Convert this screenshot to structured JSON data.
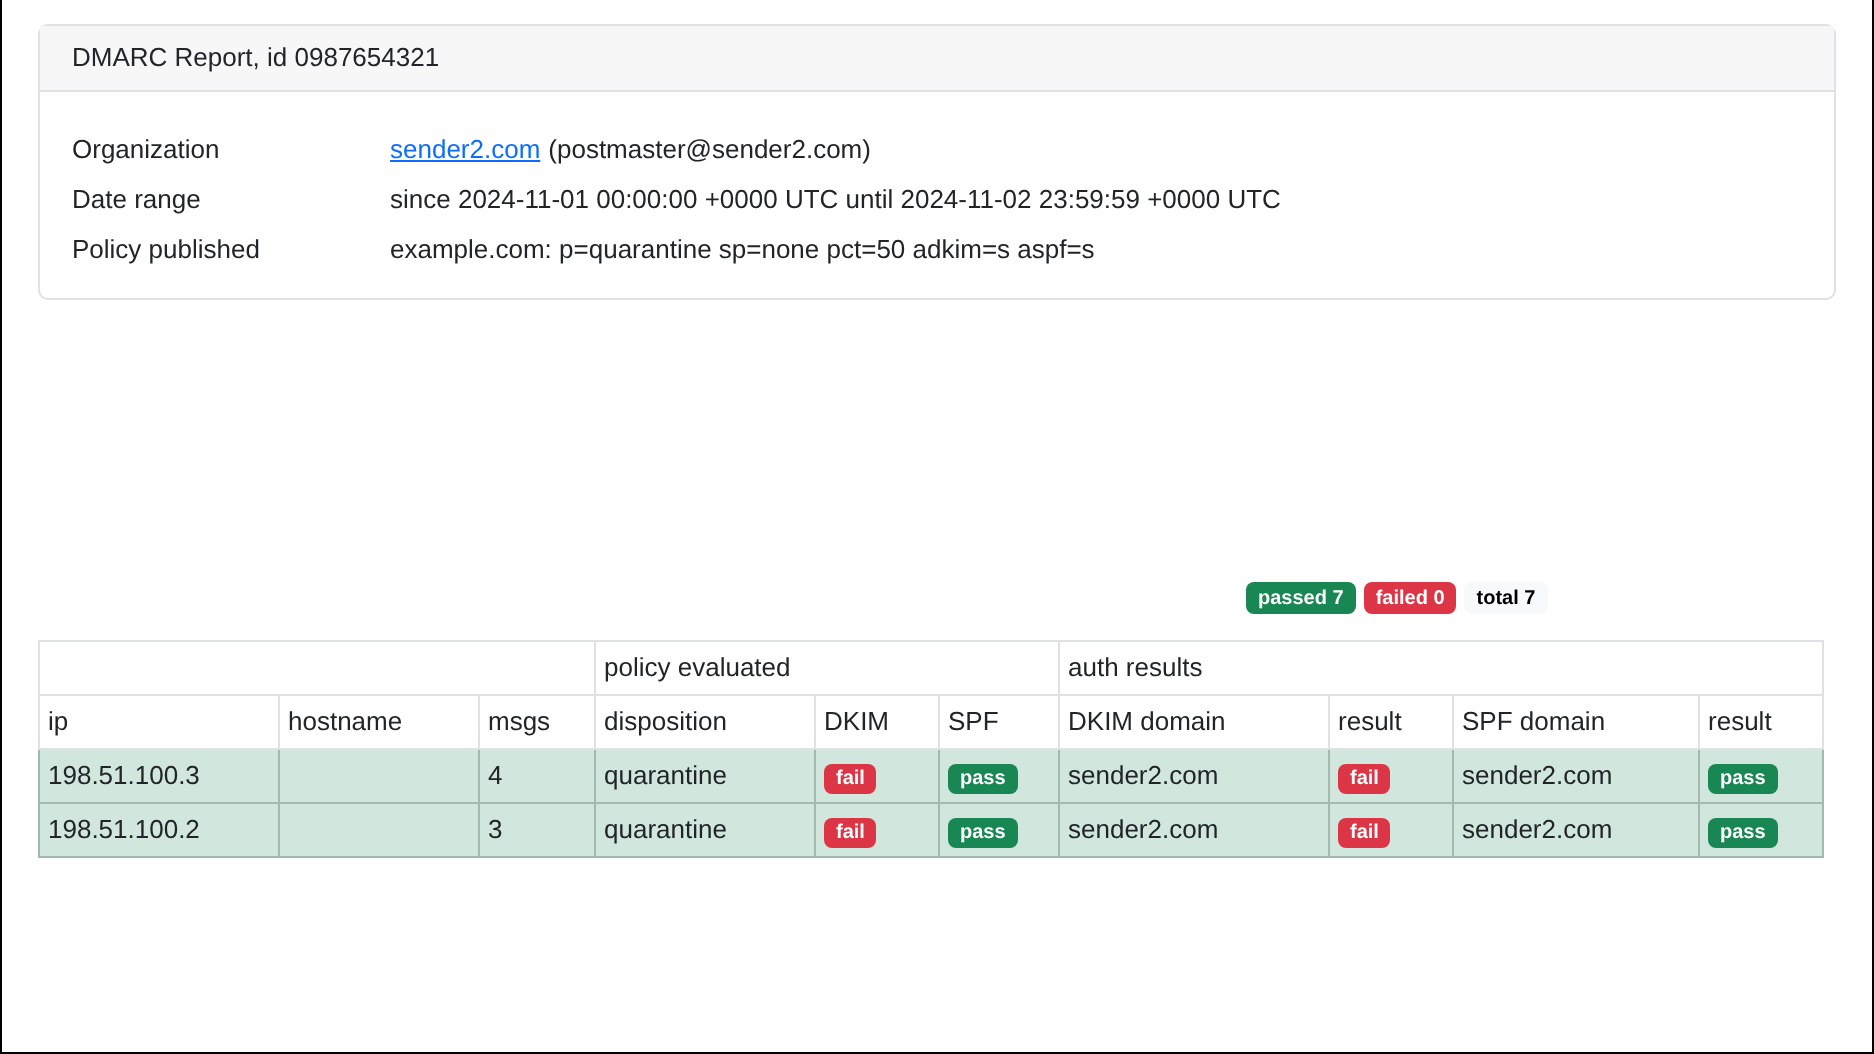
{
  "report": {
    "title": "DMARC Report, id 0987654321",
    "fields": [
      {
        "label": "Organization",
        "link": "sender2.com",
        "value": "(postmaster@sender2.com)"
      },
      {
        "label": "Date range",
        "value": "since 2024-11-01 00:00:00 +0000 UTC until 2024-11-02 23:59:59 +0000 UTC"
      },
      {
        "label": "Policy published",
        "value": "example.com: p=quarantine sp=none pct=50 adkim=s aspf=s"
      }
    ]
  },
  "summary": [
    {
      "kind": "passed",
      "text": "passed 7"
    },
    {
      "kind": "failed",
      "text": "failed 0"
    },
    {
      "kind": "total",
      "text": "total 7"
    }
  ],
  "table": {
    "groups": [
      "policy evaluated",
      "auth results"
    ],
    "columns": [
      "ip",
      "hostname",
      "msgs",
      "disposition",
      "DKIM",
      "SPF",
      "DKIM domain",
      "result",
      "SPF domain",
      "result"
    ],
    "rows": [
      {
        "cells": [
          {
            "text": "198.51.100.3"
          },
          {
            "text": ""
          },
          {
            "text": "4"
          },
          {
            "text": "quarantine"
          },
          {
            "text": "fail",
            "ok": false
          },
          {
            "text": "pass",
            "ok": true
          },
          {
            "text": "sender2.com"
          },
          {
            "text": "fail",
            "ok": false
          },
          {
            "text": "sender2.com"
          },
          {
            "text": "pass",
            "ok": true
          }
        ]
      },
      {
        "cells": [
          {
            "text": "198.51.100.2"
          },
          {
            "text": ""
          },
          {
            "text": "3"
          },
          {
            "text": "quarantine"
          },
          {
            "text": "fail",
            "ok": false
          },
          {
            "text": "pass",
            "ok": true
          },
          {
            "text": "sender2.com"
          },
          {
            "text": "fail",
            "ok": false
          },
          {
            "text": "sender2.com"
          },
          {
            "text": "pass",
            "ok": true
          }
        ]
      }
    ]
  }
}
